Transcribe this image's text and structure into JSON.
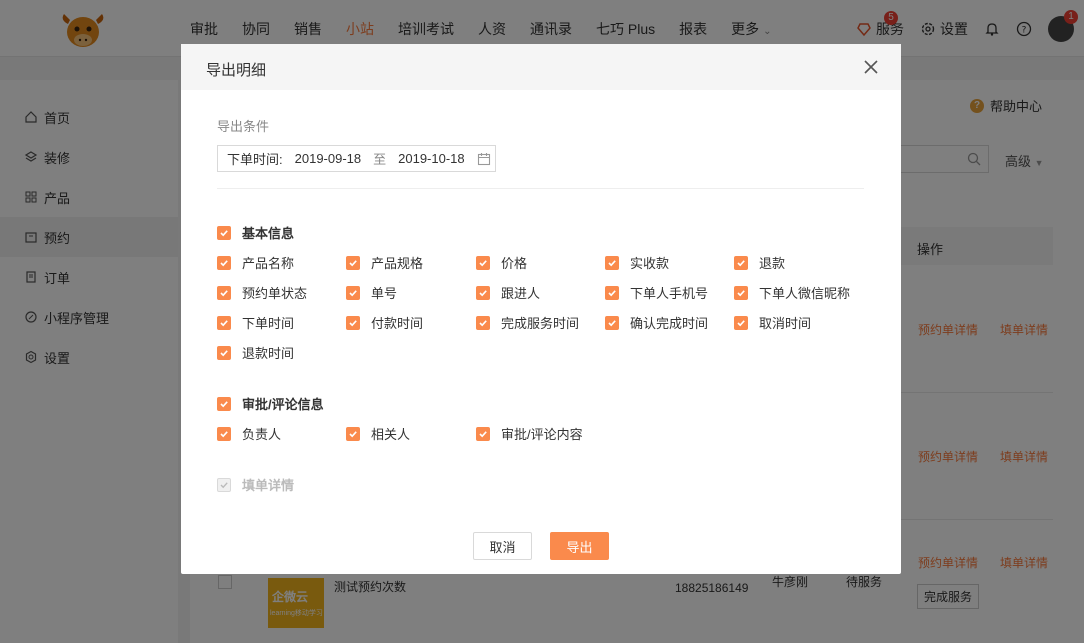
{
  "nav": {
    "items": [
      {
        "label": "审批",
        "active": false
      },
      {
        "label": "协同",
        "active": false
      },
      {
        "label": "销售",
        "active": false
      },
      {
        "label": "小站",
        "active": true
      },
      {
        "label": "培训考试",
        "active": false
      },
      {
        "label": "人资",
        "active": false
      },
      {
        "label": "通讯录",
        "active": false
      },
      {
        "label": "七巧 Plus",
        "active": false
      },
      {
        "label": "报表",
        "active": false
      },
      {
        "label": "更多",
        "active": false
      }
    ],
    "service_label": "服务",
    "service_badge": "5",
    "settings_label": "设置",
    "avatar_badge": "1"
  },
  "sidebar": {
    "items": [
      {
        "label": "首页",
        "icon": "home-icon"
      },
      {
        "label": "装修",
        "icon": "layers-icon"
      },
      {
        "label": "产品",
        "icon": "grid-icon"
      },
      {
        "label": "预约",
        "icon": "calendar-icon",
        "active": true
      },
      {
        "label": "订单",
        "icon": "document-icon"
      },
      {
        "label": "小程序管理",
        "icon": "link-icon"
      },
      {
        "label": "设置",
        "icon": "gear-icon"
      }
    ]
  },
  "background": {
    "help_label": "帮助中心",
    "advanced_label": "高级",
    "column_ops": "操作",
    "row_link_1": "预约单详情",
    "row_link_2": "填单详情",
    "row3_title": "测试预约次数",
    "row3_phone": "18825186149",
    "row3_person": "牛彦刚",
    "row3_status": "待服务",
    "row3_button": "完成服务",
    "thumb_text": "企微云",
    "thumb_sub": "learning移动学习"
  },
  "modal": {
    "title": "导出明细",
    "conditions_label": "导出条件",
    "date_label": "下单时间:",
    "date_start": "2019-09-18",
    "date_sep": "至",
    "date_end": "2019-10-18",
    "basic_group": "基本信息",
    "basic_fields": [
      "产品名称",
      "产品规格",
      "价格",
      "实收款",
      "退款",
      "预约单状态",
      "单号",
      "跟进人",
      "下单人手机号",
      "下单人微信昵称",
      "下单时间",
      "付款时间",
      "完成服务时间",
      "确认完成时间",
      "取消时间",
      "退款时间"
    ],
    "review_group": "审批/评论信息",
    "review_fields": [
      "负责人",
      "相关人",
      "审批/评论内容"
    ],
    "form_group": "填单详情",
    "cancel_label": "取消",
    "export_label": "导出"
  },
  "colors": {
    "accent": "#fa8a4c",
    "link": "#fa7b3c"
  }
}
